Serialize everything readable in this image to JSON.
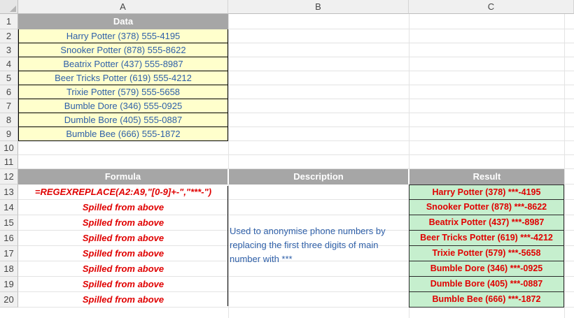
{
  "columns": [
    "A",
    "B",
    "C"
  ],
  "rows": [
    "1",
    "2",
    "3",
    "4",
    "5",
    "6",
    "7",
    "8",
    "9",
    "10",
    "11",
    "12",
    "13",
    "14",
    "15",
    "16",
    "17",
    "18",
    "19",
    "20"
  ],
  "data_header": "Data",
  "data_values": [
    "Harry Potter   (378) 555-4195",
    "Snooker Potter   (878) 555-8622",
    "Beatrix Potter   (437) 555-8987",
    "Beer Tricks Potter   (619) 555-4212",
    "Trixie Potter   (579) 555-5658",
    "Bumble Dore   (346) 555-0925",
    "Dumble Bore   (405) 555-0887",
    "Bumble Bee   (666) 555-1872"
  ],
  "headers2": {
    "formula": "Formula",
    "description": "Description",
    "result": "Result"
  },
  "formulas": [
    "=REGEXREPLACE(A2:A9,\"[0-9]+-\",\"***-\")",
    "Spilled from above",
    "Spilled from above",
    "Spilled from above",
    "Spilled from above",
    "Spilled from above",
    "Spilled from above",
    "Spilled from above"
  ],
  "description": "Used to anonymise phone numbers by replacing the first three digits of main number with ***",
  "results": [
    "Harry Potter   (378) ***-4195",
    "Snooker Potter   (878) ***-8622",
    "Beatrix Potter   (437) ***-8987",
    "Beer Tricks Potter   (619) ***-4212",
    "Trixie Potter   (579) ***-5658",
    "Bumble Dore   (346) ***-0925",
    "Dumble Bore   (405) ***-0887",
    "Bumble Bee   (666) ***-1872"
  ]
}
